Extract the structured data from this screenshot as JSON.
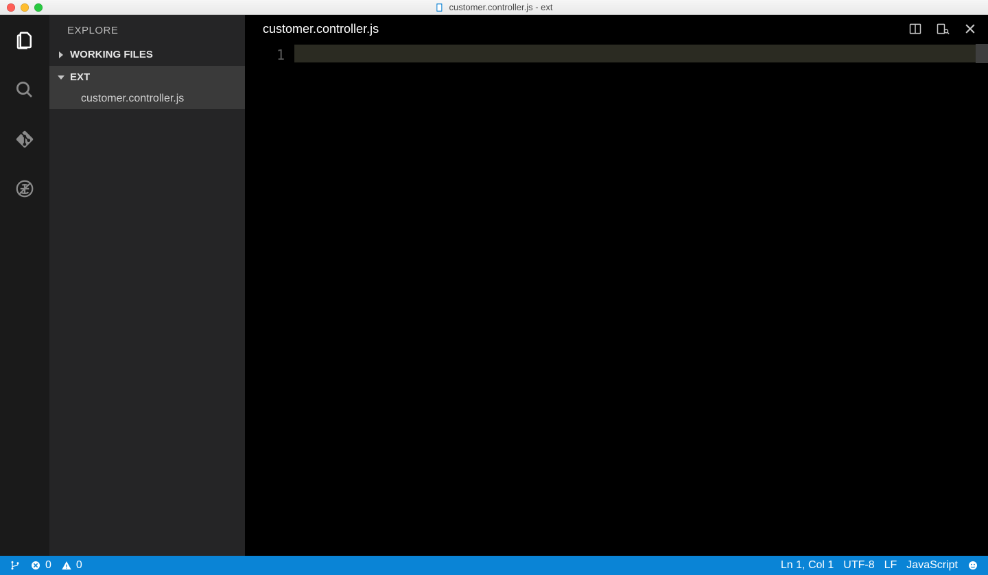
{
  "window": {
    "title": "customer.controller.js - ext"
  },
  "activitybar": {
    "items": [
      {
        "name": "explorer",
        "active": true
      },
      {
        "name": "search",
        "active": false
      },
      {
        "name": "git",
        "active": false
      },
      {
        "name": "debug",
        "active": false
      }
    ]
  },
  "sidebar": {
    "title": "EXPLORE",
    "sections": [
      {
        "label": "WORKING FILES",
        "expanded": false
      },
      {
        "label": "EXT",
        "expanded": true
      }
    ],
    "files": [
      {
        "label": "customer.controller.js",
        "selected": true
      }
    ]
  },
  "editor": {
    "tab_title": "customer.controller.js",
    "line_numbers": [
      "1"
    ]
  },
  "statusbar": {
    "errors": "0",
    "warnings": "0",
    "cursor": "Ln 1, Col 1",
    "encoding": "UTF-8",
    "eol": "LF",
    "language": "JavaScript"
  }
}
